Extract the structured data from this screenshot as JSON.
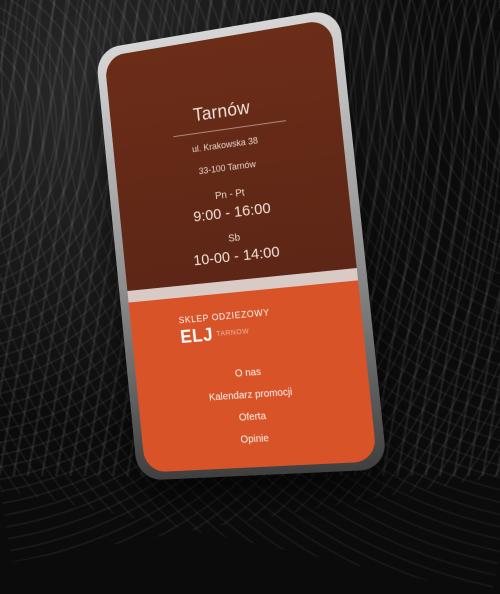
{
  "store": {
    "city": "Tarnów",
    "address_line1": "ul. Krakowska 38",
    "address_line2": "33-100 Tarnów",
    "hours": [
      {
        "days": "Pn - Pt",
        "time": "9:00 - 16:00"
      },
      {
        "days": "Sb",
        "time": "10-00 - 14:00"
      }
    ]
  },
  "brand": {
    "small": "SKLEP ODZIEZOWY",
    "big": "ELJ",
    "sub": "TARNOW"
  },
  "menu": {
    "items": [
      "O nas",
      "Kalendarz promocji",
      "Oferta",
      "Opinie"
    ]
  }
}
